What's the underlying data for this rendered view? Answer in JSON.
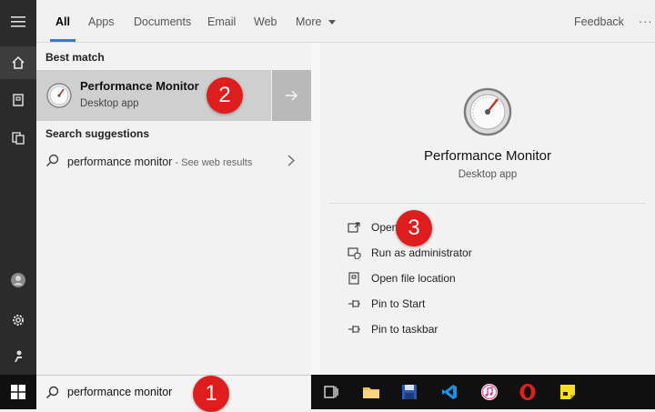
{
  "tabs": [
    {
      "label": "All"
    },
    {
      "label": "Apps"
    },
    {
      "label": "Documents"
    },
    {
      "label": "Email"
    },
    {
      "label": "Web"
    },
    {
      "label": "More"
    }
  ],
  "feedback_label": "Feedback",
  "more_options": "···",
  "best_match": {
    "header": "Best match",
    "title": "Performance Monitor",
    "subtitle": "Desktop app"
  },
  "suggestions": {
    "header": "Search suggestions",
    "query": "performance monitor",
    "suffix": " - See web results"
  },
  "detail": {
    "title": "Performance Monitor",
    "subtitle": "Desktop app",
    "actions": [
      {
        "label": "Open",
        "icon": "open-icon"
      },
      {
        "label": "Run as administrator",
        "icon": "shield-icon"
      },
      {
        "label": "Open file location",
        "icon": "folder-location-icon"
      },
      {
        "label": "Pin to Start",
        "icon": "pin-icon"
      },
      {
        "label": "Pin to taskbar",
        "icon": "pin-icon"
      }
    ]
  },
  "search": {
    "value": "performance monitor"
  },
  "badges": [
    "1",
    "2",
    "3"
  ],
  "colors": {
    "badge": "#e01d1d",
    "tab_accent": "#3a78d6",
    "taskbar": "#101010"
  }
}
